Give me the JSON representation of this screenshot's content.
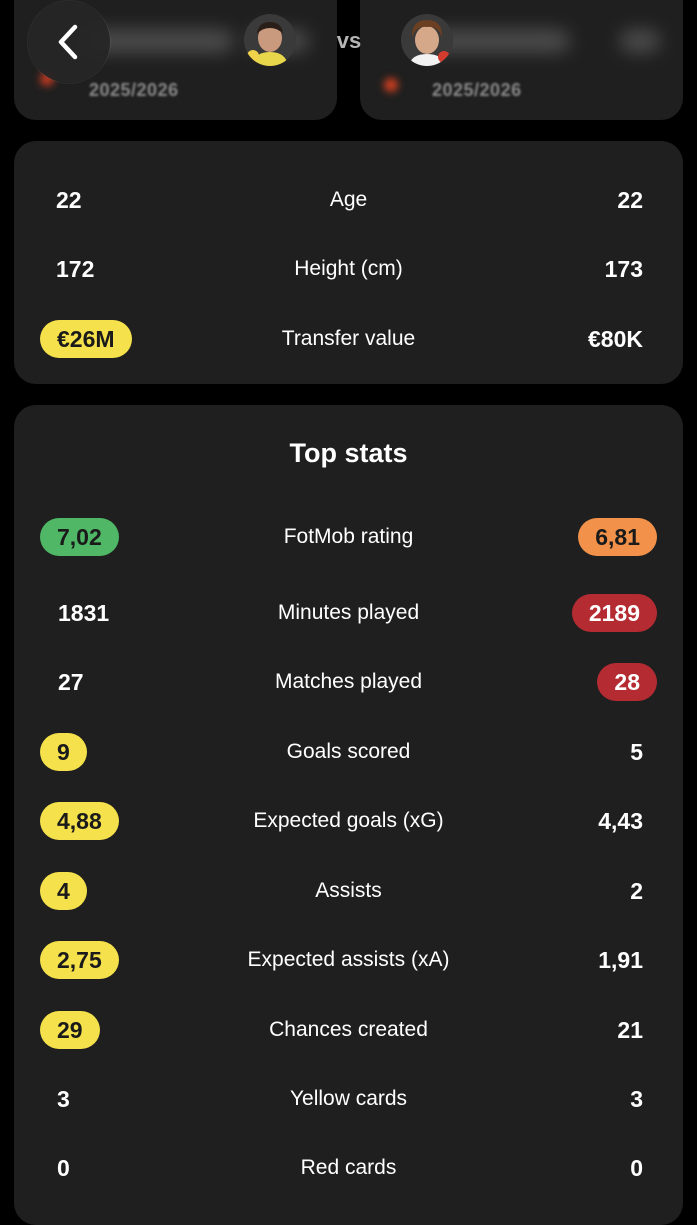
{
  "header": {
    "vs_label": "vs",
    "left_player": {
      "season": "2025/2026"
    },
    "right_player": {
      "season": "2025/2026"
    }
  },
  "info": {
    "rows": [
      {
        "label": "Age",
        "left": "22",
        "right": "22"
      },
      {
        "label": "Height (cm)",
        "left": "172",
        "right": "173"
      },
      {
        "label": "Transfer value",
        "left": "€26M",
        "right": "€80K",
        "left_highlight": "yellow"
      }
    ]
  },
  "stats": {
    "title": "Top stats",
    "rows": [
      {
        "label": "FotMob rating",
        "left": "7,02",
        "right": "6,81",
        "left_highlight": "green",
        "right_highlight": "orange"
      },
      {
        "label": "Minutes played",
        "left": "1831",
        "right": "2189",
        "right_highlight": "red"
      },
      {
        "label": "Matches played",
        "left": "27",
        "right": "28",
        "right_highlight": "red"
      },
      {
        "label": "Goals scored",
        "left": "9",
        "right": "5",
        "left_highlight": "yellow"
      },
      {
        "label": "Expected goals (xG)",
        "left": "4,88",
        "right": "4,43",
        "left_highlight": "yellow"
      },
      {
        "label": "Assists",
        "left": "4",
        "right": "2",
        "left_highlight": "yellow"
      },
      {
        "label": "Expected assists (xA)",
        "left": "2,75",
        "right": "1,91",
        "left_highlight": "yellow"
      },
      {
        "label": "Chances created",
        "left": "29",
        "right": "21",
        "left_highlight": "yellow"
      },
      {
        "label": "Yellow cards",
        "left": "3",
        "right": "3"
      },
      {
        "label": "Red cards",
        "left": "0",
        "right": "0"
      }
    ]
  },
  "colors": {
    "background": "#000000",
    "card": "#1f1f1f",
    "yellow": "#f5e14b",
    "green": "#4fb765",
    "orange": "#f2924a",
    "red": "#b52b32"
  },
  "icons": {
    "back": "chevron-left-icon"
  }
}
